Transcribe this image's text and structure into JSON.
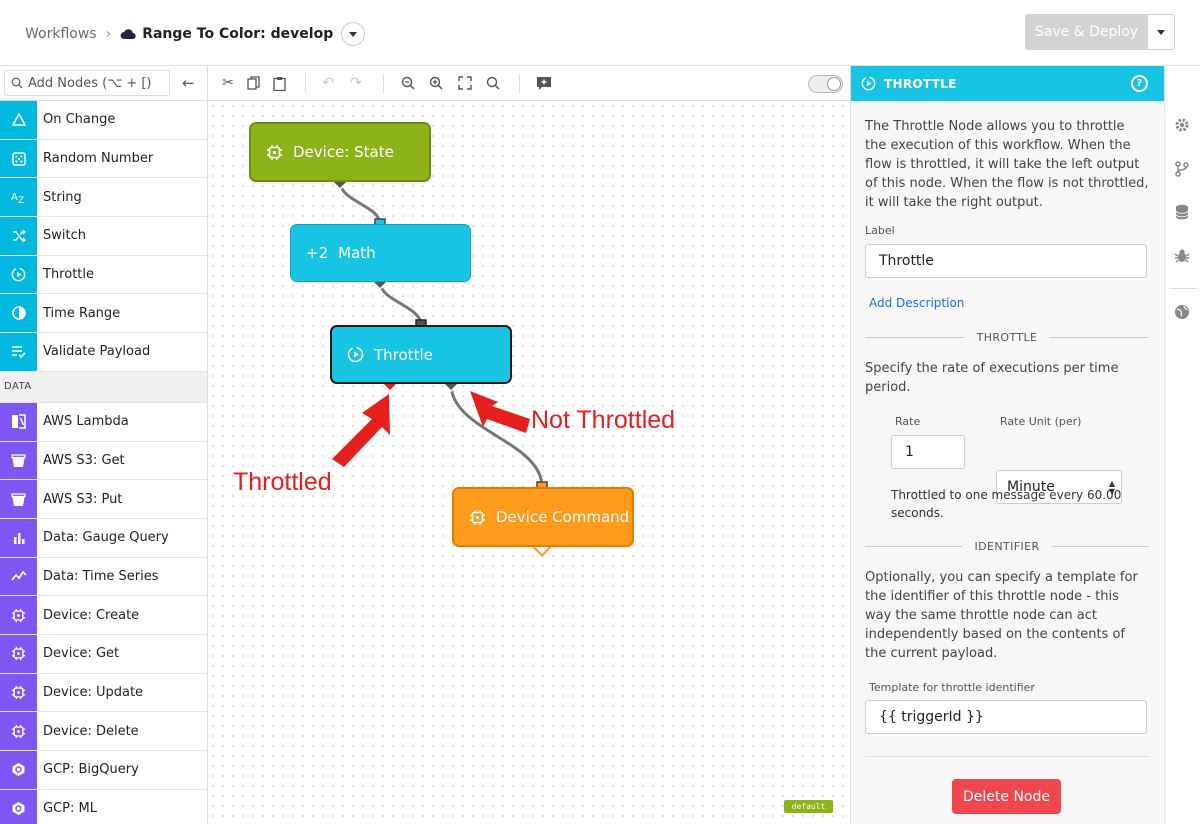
{
  "header": {
    "breadcrumb_root": "Workflows",
    "breadcrumb_sep": "›",
    "workflow_name": "Range To Color: develop",
    "deploy_label": "Save & Deploy"
  },
  "palette": {
    "search_placeholder": "Add Nodes (⌥ + [)",
    "items_top": [
      {
        "label": "On Change",
        "icon": "triangle-icon"
      },
      {
        "label": "Random Number",
        "icon": "dice-icon"
      },
      {
        "label": "String",
        "icon": "az-icon"
      },
      {
        "label": "Switch",
        "icon": "shuffle-icon"
      },
      {
        "label": "Throttle",
        "icon": "play-circle-icon"
      },
      {
        "label": "Time Range",
        "icon": "clock-icon"
      },
      {
        "label": "Validate Payload",
        "icon": "checklist-icon"
      }
    ],
    "section_label": "DATA",
    "items_data": [
      {
        "label": "AWS Lambda",
        "icon": "lambda-icon"
      },
      {
        "label": "AWS S3: Get",
        "icon": "bucket-icon"
      },
      {
        "label": "AWS S3: Put",
        "icon": "bucket-icon"
      },
      {
        "label": "Data: Gauge Query",
        "icon": "bar-chart-icon"
      },
      {
        "label": "Data: Time Series",
        "icon": "line-chart-icon"
      },
      {
        "label": "Device: Create",
        "icon": "chip-icon"
      },
      {
        "label": "Device: Get",
        "icon": "chip-icon"
      },
      {
        "label": "Device: Update",
        "icon": "chip-icon"
      },
      {
        "label": "Device: Delete",
        "icon": "chip-icon"
      },
      {
        "label": "GCP: BigQuery",
        "icon": "gcp-icon"
      },
      {
        "label": "GCP: ML",
        "icon": "gcp-icon"
      }
    ]
  },
  "canvas": {
    "nodes": {
      "device_state": "Device: State",
      "math_prefix": "+2",
      "math": "Math",
      "throttle": "Throttle",
      "device_command": "Device Command"
    },
    "annotation_throttled": "Throttled",
    "annotation_not_throttled": "Not Throttled",
    "default_tag": "default"
  },
  "panel": {
    "title": "THROTTLE",
    "help": "?",
    "description": "The Throttle Node allows you to throttle the execution of this workflow. When the flow is throttled, it will take the left output of this node. When the flow is not throttled, it will take the right output.",
    "label_caption": "Label",
    "label_value": "Throttle",
    "add_description": "Add Description",
    "section_throttle": "THROTTLE",
    "rate_text": "Specify the rate of executions per time period.",
    "rate_caption": "Rate",
    "rate_value": "1",
    "rate_unit_caption": "Rate Unit (per)",
    "rate_unit_value": "Minute",
    "throttle_summary": "Throttled to one message every 60.00 seconds.",
    "section_identifier": "IDENTIFIER",
    "identifier_text": "Optionally, you can specify a template for the identifier of this throttle node - this way the same throttle node can act independently based on the contents of the current payload.",
    "template_caption": "Template for throttle identifier",
    "template_value": "{{ triggerId }}",
    "delete_label": "Delete Node"
  },
  "colors": {
    "cyan": "#17c4e4",
    "purple": "#7e57f2",
    "green": "#8cb319",
    "orange": "#ff9b1a",
    "red": "#e61e1e",
    "delete": "#f0474f"
  }
}
